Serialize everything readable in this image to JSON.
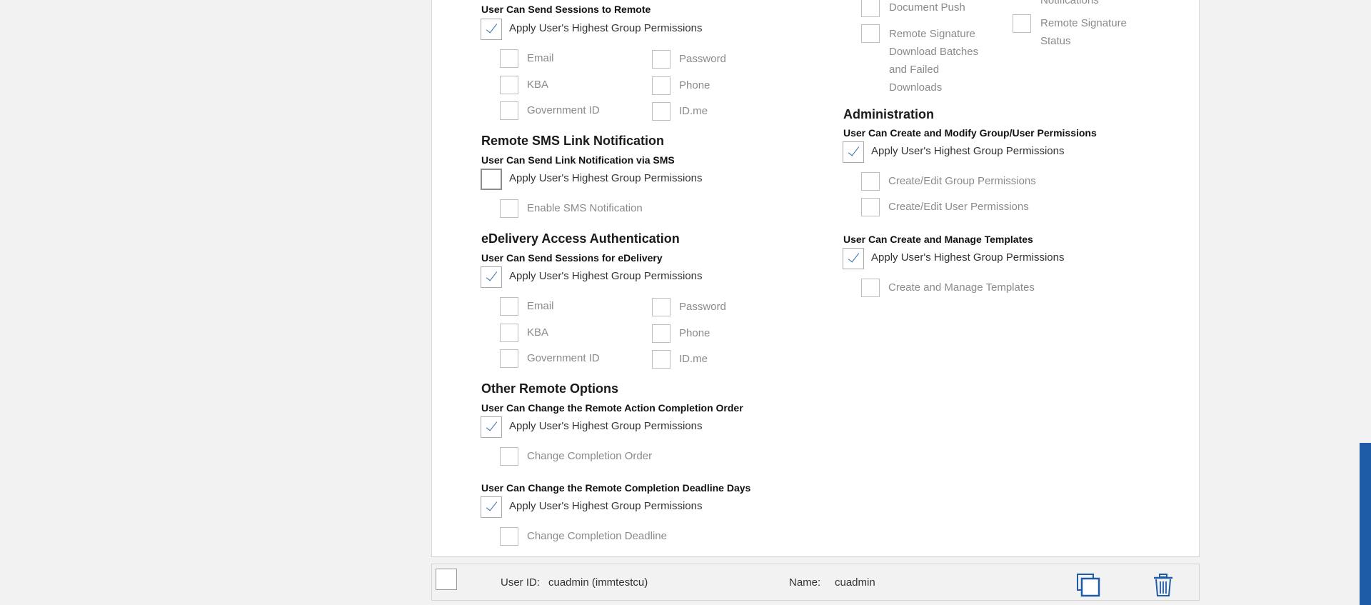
{
  "left": {
    "remote_section": {
      "subtitle": "User Can Send Sessions to Remote",
      "apply_label": "Apply User's Highest Group Permissions",
      "apply_checked": true,
      "options": {
        "email": "Email",
        "password": "Password",
        "kba": "KBA",
        "phone": "Phone",
        "gov_id": "Government ID",
        "idme": "ID.me"
      }
    },
    "sms_section": {
      "title": "Remote SMS Link Notification",
      "subtitle": "User Can Send Link Notification via SMS",
      "apply_label": "Apply User's Highest Group Permissions",
      "apply_checked": false,
      "option": "Enable SMS Notification"
    },
    "edelivery_section": {
      "title": "eDelivery Access Authentication",
      "subtitle": "User Can Send Sessions for eDelivery",
      "apply_label": "Apply User's Highest Group Permissions",
      "apply_checked": true,
      "options": {
        "email": "Email",
        "password": "Password",
        "kba": "KBA",
        "phone": "Phone",
        "gov_id": "Government ID",
        "idme": "ID.me"
      }
    },
    "other_section": {
      "title": "Other Remote Options",
      "order": {
        "subtitle": "User Can Change the Remote Action Completion Order",
        "apply_label": "Apply User's Highest Group Permissions",
        "apply_checked": true,
        "option": "Change Completion Order"
      },
      "deadline": {
        "subtitle": "User Can Change the Remote Completion Deadline Days",
        "apply_label": "Apply User's Highest Group Permissions",
        "apply_checked": true,
        "option": "Change Completion Deadline"
      }
    }
  },
  "right": {
    "top_options": {
      "notifications": "Notifications",
      "document_push": "Document Push",
      "remote_sig_download": "Remote Signature Download Batches and Failed Downloads",
      "remote_sig_status": "Remote Signature Status"
    },
    "admin_section": {
      "title": "Administration",
      "perm": {
        "subtitle": "User Can Create and Modify Group/User Permissions",
        "apply_label": "Apply User's Highest Group Permissions",
        "apply_checked": true,
        "opt_group": "Create/Edit Group Permissions",
        "opt_user": "Create/Edit User Permissions"
      },
      "templates": {
        "subtitle": "User Can Create and Manage Templates",
        "apply_label": "Apply User's Highest Group Permissions",
        "apply_checked": true,
        "option": "Create and Manage Templates"
      }
    }
  },
  "footer": {
    "user_id_label": "User ID:",
    "user_id_value": "cuadmin (immtestcu)",
    "name_label": "Name:",
    "name_value": "cuadmin",
    "copy_icon": "copy-icon",
    "delete_icon": "trash-icon"
  },
  "colors": {
    "accent": "#2f6fb3",
    "scrollbar": "#1f5ca8"
  }
}
